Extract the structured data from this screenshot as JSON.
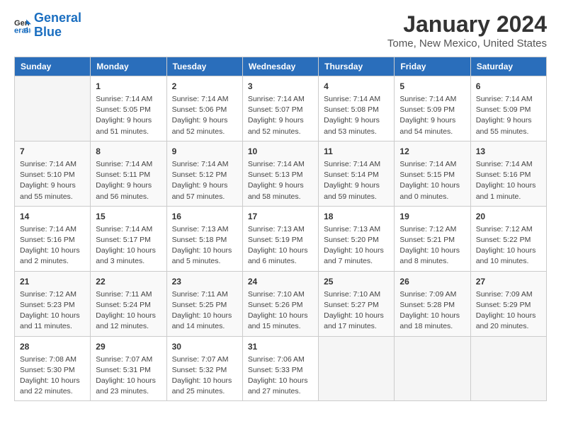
{
  "logo": {
    "line1": "General",
    "line2": "Blue"
  },
  "title": "January 2024",
  "subtitle": "Tome, New Mexico, United States",
  "days_of_week": [
    "Sunday",
    "Monday",
    "Tuesday",
    "Wednesday",
    "Thursday",
    "Friday",
    "Saturday"
  ],
  "weeks": [
    [
      {
        "num": "",
        "info": ""
      },
      {
        "num": "1",
        "info": "Sunrise: 7:14 AM\nSunset: 5:05 PM\nDaylight: 9 hours\nand 51 minutes."
      },
      {
        "num": "2",
        "info": "Sunrise: 7:14 AM\nSunset: 5:06 PM\nDaylight: 9 hours\nand 52 minutes."
      },
      {
        "num": "3",
        "info": "Sunrise: 7:14 AM\nSunset: 5:07 PM\nDaylight: 9 hours\nand 52 minutes."
      },
      {
        "num": "4",
        "info": "Sunrise: 7:14 AM\nSunset: 5:08 PM\nDaylight: 9 hours\nand 53 minutes."
      },
      {
        "num": "5",
        "info": "Sunrise: 7:14 AM\nSunset: 5:09 PM\nDaylight: 9 hours\nand 54 minutes."
      },
      {
        "num": "6",
        "info": "Sunrise: 7:14 AM\nSunset: 5:09 PM\nDaylight: 9 hours\nand 55 minutes."
      }
    ],
    [
      {
        "num": "7",
        "info": "Sunrise: 7:14 AM\nSunset: 5:10 PM\nDaylight: 9 hours\nand 55 minutes."
      },
      {
        "num": "8",
        "info": "Sunrise: 7:14 AM\nSunset: 5:11 PM\nDaylight: 9 hours\nand 56 minutes."
      },
      {
        "num": "9",
        "info": "Sunrise: 7:14 AM\nSunset: 5:12 PM\nDaylight: 9 hours\nand 57 minutes."
      },
      {
        "num": "10",
        "info": "Sunrise: 7:14 AM\nSunset: 5:13 PM\nDaylight: 9 hours\nand 58 minutes."
      },
      {
        "num": "11",
        "info": "Sunrise: 7:14 AM\nSunset: 5:14 PM\nDaylight: 9 hours\nand 59 minutes."
      },
      {
        "num": "12",
        "info": "Sunrise: 7:14 AM\nSunset: 5:15 PM\nDaylight: 10 hours\nand 0 minutes."
      },
      {
        "num": "13",
        "info": "Sunrise: 7:14 AM\nSunset: 5:16 PM\nDaylight: 10 hours\nand 1 minute."
      }
    ],
    [
      {
        "num": "14",
        "info": "Sunrise: 7:14 AM\nSunset: 5:16 PM\nDaylight: 10 hours\nand 2 minutes."
      },
      {
        "num": "15",
        "info": "Sunrise: 7:14 AM\nSunset: 5:17 PM\nDaylight: 10 hours\nand 3 minutes."
      },
      {
        "num": "16",
        "info": "Sunrise: 7:13 AM\nSunset: 5:18 PM\nDaylight: 10 hours\nand 5 minutes."
      },
      {
        "num": "17",
        "info": "Sunrise: 7:13 AM\nSunset: 5:19 PM\nDaylight: 10 hours\nand 6 minutes."
      },
      {
        "num": "18",
        "info": "Sunrise: 7:13 AM\nSunset: 5:20 PM\nDaylight: 10 hours\nand 7 minutes."
      },
      {
        "num": "19",
        "info": "Sunrise: 7:12 AM\nSunset: 5:21 PM\nDaylight: 10 hours\nand 8 minutes."
      },
      {
        "num": "20",
        "info": "Sunrise: 7:12 AM\nSunset: 5:22 PM\nDaylight: 10 hours\nand 10 minutes."
      }
    ],
    [
      {
        "num": "21",
        "info": "Sunrise: 7:12 AM\nSunset: 5:23 PM\nDaylight: 10 hours\nand 11 minutes."
      },
      {
        "num": "22",
        "info": "Sunrise: 7:11 AM\nSunset: 5:24 PM\nDaylight: 10 hours\nand 12 minutes."
      },
      {
        "num": "23",
        "info": "Sunrise: 7:11 AM\nSunset: 5:25 PM\nDaylight: 10 hours\nand 14 minutes."
      },
      {
        "num": "24",
        "info": "Sunrise: 7:10 AM\nSunset: 5:26 PM\nDaylight: 10 hours\nand 15 minutes."
      },
      {
        "num": "25",
        "info": "Sunrise: 7:10 AM\nSunset: 5:27 PM\nDaylight: 10 hours\nand 17 minutes."
      },
      {
        "num": "26",
        "info": "Sunrise: 7:09 AM\nSunset: 5:28 PM\nDaylight: 10 hours\nand 18 minutes."
      },
      {
        "num": "27",
        "info": "Sunrise: 7:09 AM\nSunset: 5:29 PM\nDaylight: 10 hours\nand 20 minutes."
      }
    ],
    [
      {
        "num": "28",
        "info": "Sunrise: 7:08 AM\nSunset: 5:30 PM\nDaylight: 10 hours\nand 22 minutes."
      },
      {
        "num": "29",
        "info": "Sunrise: 7:07 AM\nSunset: 5:31 PM\nDaylight: 10 hours\nand 23 minutes."
      },
      {
        "num": "30",
        "info": "Sunrise: 7:07 AM\nSunset: 5:32 PM\nDaylight: 10 hours\nand 25 minutes."
      },
      {
        "num": "31",
        "info": "Sunrise: 7:06 AM\nSunset: 5:33 PM\nDaylight: 10 hours\nand 27 minutes."
      },
      {
        "num": "",
        "info": ""
      },
      {
        "num": "",
        "info": ""
      },
      {
        "num": "",
        "info": ""
      }
    ]
  ]
}
